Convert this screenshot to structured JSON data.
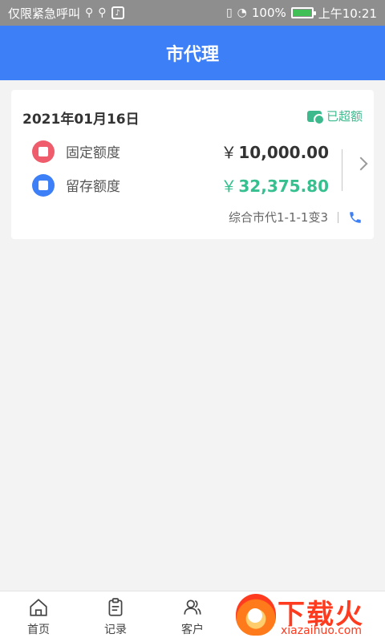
{
  "statusbar": {
    "left_text": "仅限紧急呼叫",
    "battery": "100%",
    "battery_level": 1.0,
    "time": "上午10:21"
  },
  "header": {
    "title": "市代理"
  },
  "card": {
    "date": "2021年01月16日",
    "status_label": "已超额",
    "rows": [
      {
        "label": "固定额度",
        "currency": "￥",
        "value": "10,000.00"
      },
      {
        "label": "留存额度",
        "currency": "￥",
        "value": "32,375.80"
      }
    ],
    "footer_text": "综合市代1-1-1变3"
  },
  "nav": {
    "items": [
      {
        "label": "首页",
        "icon": "home-icon"
      },
      {
        "label": "记录",
        "icon": "record-icon"
      },
      {
        "label": "客户",
        "icon": "customer-icon"
      }
    ]
  },
  "watermark": {
    "text": "下载火",
    "sub": "xiazaihuo.com"
  },
  "colors": {
    "primary": "#3d7ff6",
    "green": "#36c08f",
    "red": "#ef5d6c"
  }
}
